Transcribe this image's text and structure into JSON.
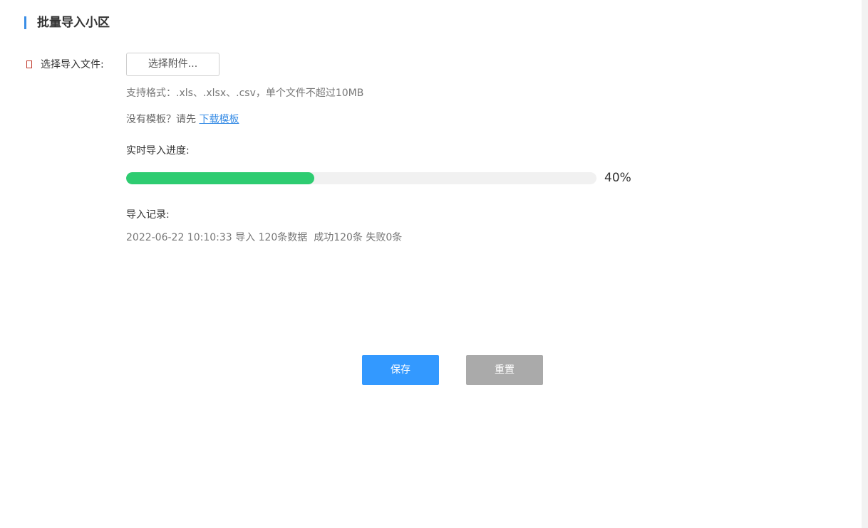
{
  "header": {
    "title": "批量导入小区",
    "accent_color": "#3a8ee6"
  },
  "form": {
    "file_field": {
      "label": "选择导入文件:",
      "required_icon": "required-marker-icon",
      "button_label": "选择附件..."
    },
    "format_hint": "支持格式：.xls、.xlsx、.csv，单个文件不超过10MB",
    "template": {
      "prefix": "没有模板？请先 ",
      "link_label": "下载模板",
      "link_color": "#3a8ee6"
    },
    "progress": {
      "label": "实时导入进度:",
      "value": 0.4,
      "percent_text": "40%",
      "fill_color": "#2ecc71",
      "track_color": "#f1f1f1"
    },
    "records": {
      "label": "导入记录:",
      "entries": [
        "2022-06-22 10:10:33 导入 120条数据  成功120条 失败0条"
      ]
    }
  },
  "actions": {
    "save_label": "保存",
    "save_color": "#3399ff",
    "reset_label": "重置",
    "reset_color": "#aaaaaa"
  }
}
